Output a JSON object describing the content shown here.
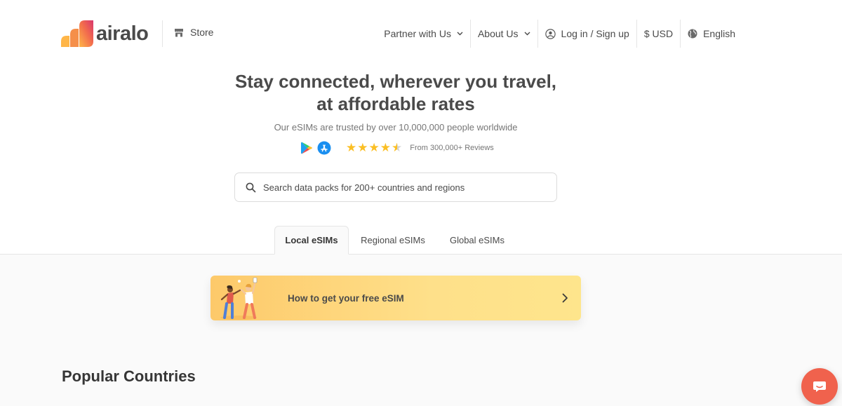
{
  "brand": {
    "name": "airalo"
  },
  "header": {
    "store_label": "Store",
    "nav": {
      "partner": "Partner with Us",
      "about": "About Us",
      "login": "Log in / Sign up",
      "currency": "$ USD",
      "language": "English"
    }
  },
  "hero": {
    "title_line1": "Stay connected, wherever you travel,",
    "title_line2": "at affordable rates",
    "subtitle": "Our eSIMs are trusted by over 10,000,000 people worldwide",
    "rating": 4.5,
    "reviews": "From 300,000+ Reviews"
  },
  "search": {
    "placeholder": "Search data packs for 200+ countries and regions"
  },
  "tabs": [
    {
      "label": "Local eSIMs",
      "active": true
    },
    {
      "label": "Regional eSIMs",
      "active": false
    },
    {
      "label": "Global eSIMs",
      "active": false
    }
  ],
  "promo": {
    "text": "How to get your free eSIM"
  },
  "section": {
    "title": "Popular Countries"
  },
  "colors": {
    "accent": "#f0624d",
    "star": "#fbbf24",
    "promo_start": "#fdc96a",
    "promo_end": "#fee58c"
  },
  "icons": [
    "store-icon",
    "chevron-down-icon",
    "user-circle-icon",
    "globe-icon",
    "google-play-icon",
    "app-store-icon",
    "star-icon",
    "search-icon",
    "chevron-right-icon",
    "chat-icon"
  ]
}
